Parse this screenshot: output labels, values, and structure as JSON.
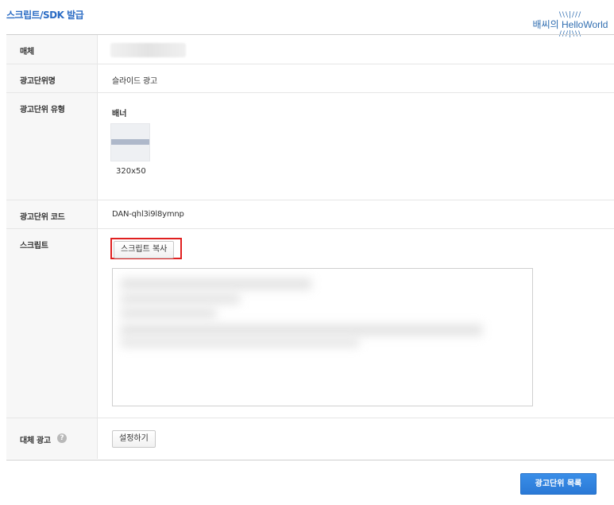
{
  "page": {
    "title": "스크립트/SDK 발급"
  },
  "watermark": {
    "text": "배씨의 HelloWorld"
  },
  "rows": {
    "media": {
      "label": "매체"
    },
    "unit_name": {
      "label": "광고단위명",
      "value": "슬라이드 광고"
    },
    "unit_type": {
      "label": "광고단위 유형",
      "type_name": "배너",
      "size": "320x50"
    },
    "unit_code": {
      "label": "광고단위 코드",
      "value": "DAN-qhl3i9l8ymnp"
    },
    "script": {
      "label": "스크립트",
      "copy_button": "스크립트 복사"
    },
    "fallback": {
      "label": "대체 광고",
      "help_icon": "?",
      "setup_button": "설정하기"
    }
  },
  "footer": {
    "list_button": "광고단위 목록"
  },
  "colors": {
    "accent": "#2b6cc4",
    "primary_button": "#2a79d6",
    "highlight": "#e02020"
  }
}
